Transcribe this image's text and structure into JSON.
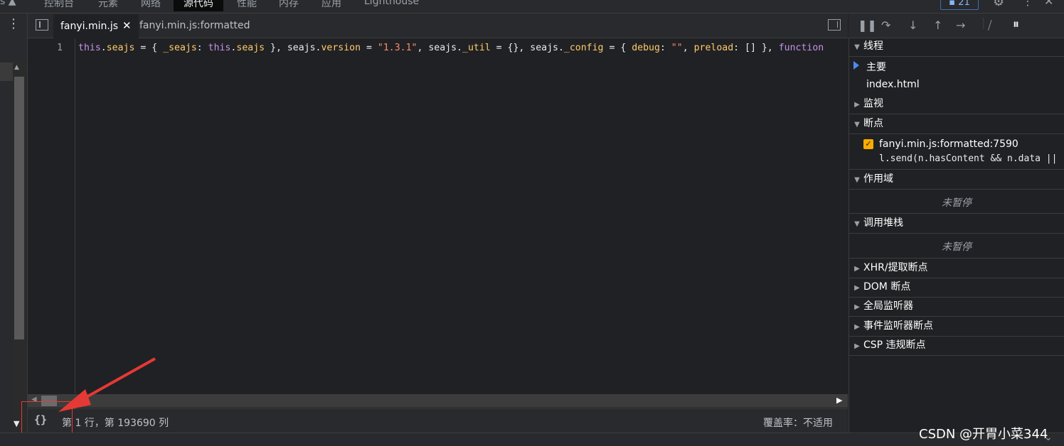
{
  "top_tabs": [
    "控制台",
    "元素",
    "网络",
    "源代码",
    "性能",
    "内存",
    "应用",
    "Lighthouse"
  ],
  "top_tab_active": "源代码",
  "top_left_text": "s ▲",
  "issues_count": "21",
  "editor_tabs": [
    {
      "label": "fanyi.min.js",
      "active": true
    },
    {
      "label": "fanyi.min.js:formatted",
      "active": false
    }
  ],
  "editor": {
    "line_number": "1",
    "code_tokens": [
      {
        "t": "this",
        "c": "kw"
      },
      {
        "t": ".",
        "c": "var"
      },
      {
        "t": "seajs",
        "c": "prop"
      },
      {
        "t": " = { ",
        "c": "var"
      },
      {
        "t": "_seajs",
        "c": "prop"
      },
      {
        "t": ": ",
        "c": "var"
      },
      {
        "t": "this",
        "c": "kw"
      },
      {
        "t": ".",
        "c": "var"
      },
      {
        "t": "seajs",
        "c": "prop"
      },
      {
        "t": " }, seajs.",
        "c": "var"
      },
      {
        "t": "version",
        "c": "prop"
      },
      {
        "t": " = ",
        "c": "var"
      },
      {
        "t": "\"1.3.1\"",
        "c": "str"
      },
      {
        "t": ", seajs.",
        "c": "var"
      },
      {
        "t": "_util",
        "c": "prop"
      },
      {
        "t": " = {}, seajs.",
        "c": "var"
      },
      {
        "t": "_config",
        "c": "prop"
      },
      {
        "t": " = { ",
        "c": "var"
      },
      {
        "t": "debug",
        "c": "prop"
      },
      {
        "t": ": ",
        "c": "var"
      },
      {
        "t": "\"\"",
        "c": "str"
      },
      {
        "t": ", ",
        "c": "var"
      },
      {
        "t": "preload",
        "c": "prop"
      },
      {
        "t": ": [] }, ",
        "c": "var"
      },
      {
        "t": "function",
        "c": "fn"
      }
    ]
  },
  "status": {
    "pretty_print": "{}",
    "cursor_position": "第 1 行，第 193690 列",
    "coverage": "覆盖率：不适用"
  },
  "debugger": {
    "threads": {
      "title": "线程",
      "items": [
        "主要",
        "index.html"
      ]
    },
    "watch": {
      "title": "监视"
    },
    "breakpoints": {
      "title": "断点",
      "items": [
        {
          "location": "fanyi.min.js:formatted:7590",
          "code": "l.send(n.hasContent && n.data || null)"
        }
      ]
    },
    "scope": {
      "title": "作用域",
      "empty": "未暂停"
    },
    "call_stack": {
      "title": "调用堆栈",
      "empty": "未暂停"
    },
    "xhr": {
      "title": "XHR/提取断点"
    },
    "dom": {
      "title": "DOM 断点"
    },
    "global": {
      "title": "全局监听器"
    },
    "event": {
      "title": "事件监听器断点"
    },
    "csp": {
      "title": "CSP 违规断点"
    }
  },
  "watermark": "CSDN @开胃小菜344",
  "colors": {
    "accent": "#4c8bf5",
    "breakpoint": "#f9ab00",
    "annotation": "#e53935"
  }
}
